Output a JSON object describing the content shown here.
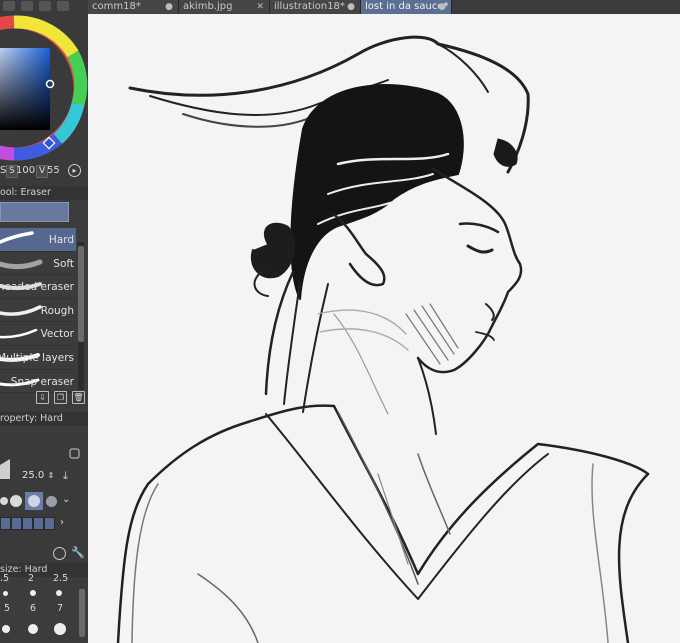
{
  "tabs": [
    {
      "label": "comm18*",
      "close": "●",
      "active": false
    },
    {
      "label": "akimb.jpg",
      "close": "✕",
      "active": false
    },
    {
      "label": "illustration18*",
      "close": "●",
      "active": false
    },
    {
      "label": "lost in da sauce*",
      "close": "●",
      "active": true
    }
  ],
  "color_panel": {
    "h_label": "S",
    "s_label": "S",
    "s_value": "100",
    "v_label": "V",
    "v_value": "55"
  },
  "sub_tool": {
    "header": "ool: Eraser",
    "brushes": [
      {
        "label": "Hard",
        "selected": true
      },
      {
        "label": "Soft",
        "selected": false
      },
      {
        "label": "Kneaded eraser",
        "selected": false
      },
      {
        "label": "Rough",
        "selected": false
      },
      {
        "label": "Vector",
        "selected": false
      },
      {
        "label": "Multiple layers",
        "selected": false
      },
      {
        "label": "Snap eraser",
        "selected": false
      }
    ]
  },
  "tool_property": {
    "header": "roperty: Hard",
    "size_value": "25.0"
  },
  "brush_size": {
    "header": "size: Hard",
    "top_numbers": [
      ".5",
      "2",
      "2.5"
    ],
    "row_numbers": [
      "5",
      "6",
      "7"
    ]
  },
  "colors": {
    "accent": "#5b6e93",
    "panel": "#3c3c3c",
    "canvas": "#f4f4f4"
  }
}
